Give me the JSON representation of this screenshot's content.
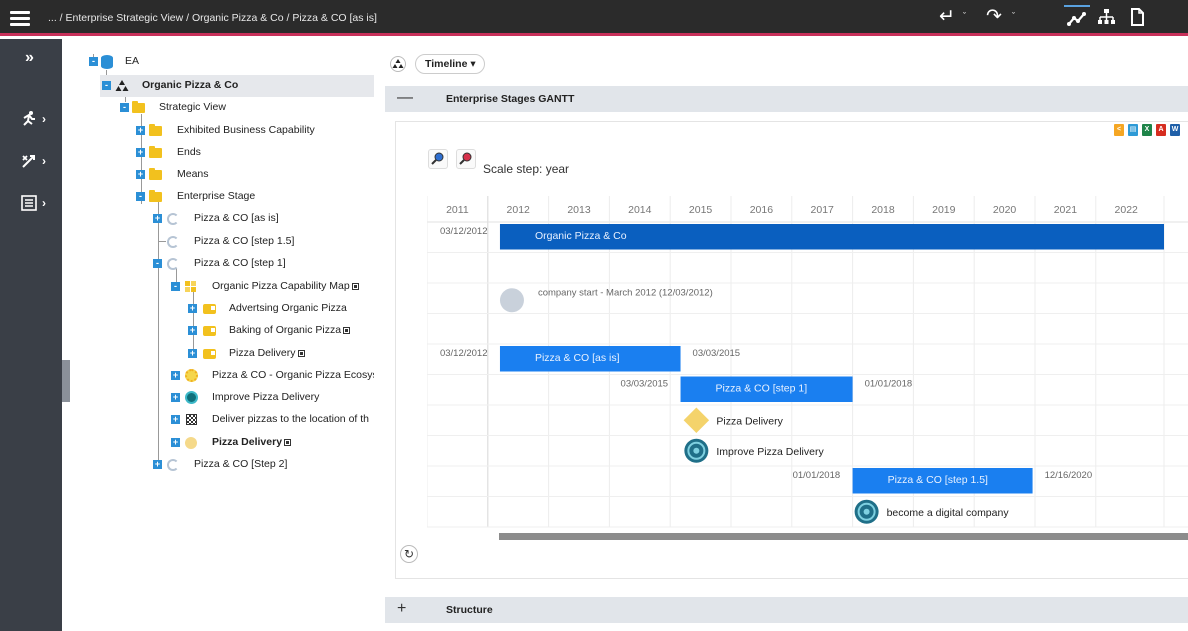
{
  "topbar": {
    "breadcrumb": "... / Enterprise Strategic View / Organic Pizza & Co / Pizza & CO [as is]",
    "icons": [
      "menu-icon",
      "undo-icon",
      "redo-icon",
      "trend-icon",
      "hierarchy-icon",
      "document-icon"
    ]
  },
  "rail": {
    "items": [
      "expand-icon",
      "runner-icon",
      "strategy-icon",
      "list-icon"
    ]
  },
  "tree": {
    "items": [
      {
        "label": "EA",
        "icon": "database-icon",
        "bold": false
      },
      {
        "label": "Organic Pizza & Co",
        "icon": "organization-icon",
        "bold": true
      },
      {
        "label": "Strategic View",
        "icon": "folder-icon",
        "bold": false
      },
      {
        "label": "Exhibited Business Capability",
        "icon": "folder-icon",
        "bold": false
      },
      {
        "label": "Ends",
        "icon": "folder-icon",
        "bold": false
      },
      {
        "label": "Means",
        "icon": "folder-icon",
        "bold": false
      },
      {
        "label": "Enterprise Stage",
        "icon": "folder-icon",
        "bold": false
      },
      {
        "label": "Pizza & CO [as is]",
        "icon": "stage-icon",
        "bold": false
      },
      {
        "label": "Pizza & CO [step 1.5]",
        "icon": "stage-icon",
        "bold": false
      },
      {
        "label": "Pizza & CO [step 1]",
        "icon": "stage-icon",
        "bold": false
      },
      {
        "label": "Organic Pizza Capability Map",
        "icon": "capability-map-icon",
        "bold": false
      },
      {
        "label": "Advertsing Organic Pizza",
        "icon": "capability-icon",
        "bold": false
      },
      {
        "label": "Baking of Organic Pizza",
        "icon": "capability-icon",
        "bold": false
      },
      {
        "label": "Pizza Delivery",
        "icon": "capability-icon",
        "bold": false
      },
      {
        "label": "Pizza & CO - Organic Pizza Ecosys",
        "icon": "ecosystem-icon",
        "bold": false
      },
      {
        "label": "Improve Pizza Delivery",
        "icon": "goal-icon",
        "bold": false
      },
      {
        "label": "Deliver pizzas to the location of th",
        "icon": "checkered-icon",
        "bold": false
      },
      {
        "label": "Pizza Delivery",
        "icon": "value-icon",
        "bold": true
      },
      {
        "label": "Pizza & CO [Step 2]",
        "icon": "stage-icon",
        "bold": false
      }
    ]
  },
  "main": {
    "view_select": "Timeline",
    "view_caret": "▾",
    "sections": {
      "gantt_title": "Enterprise Stages GANTT",
      "gantt_toggle": "—",
      "structure_title": "Structure",
      "structure_toggle": "+"
    },
    "scale_text": "Scale step: year",
    "reset_glyph": "↻",
    "exports": [
      {
        "icon": "share-icon",
        "color": "#f5a623",
        "glyph": "<"
      },
      {
        "icon": "doc-icon",
        "color": "#2e9ad6",
        "glyph": "▤"
      },
      {
        "icon": "excel-icon",
        "color": "#1e8449",
        "glyph": "X"
      },
      {
        "icon": "pdf-icon",
        "color": "#d62d20",
        "glyph": "A"
      },
      {
        "icon": "word-icon",
        "color": "#1f5fa8",
        "glyph": "W"
      }
    ]
  },
  "chart_data": {
    "type": "gantt",
    "years": [
      "2011",
      "2012",
      "2013",
      "2014",
      "2015",
      "2016",
      "2017",
      "2018",
      "2019",
      "2020",
      "2021",
      "2022"
    ],
    "rows": [
      {
        "kind": "bar",
        "label": "Organic Pizza & Co",
        "start_label": "03/12/2012",
        "end_label": "",
        "start": 2012.2,
        "end": 2023.2,
        "color": "#0a5fbf"
      },
      {
        "kind": "empty"
      },
      {
        "kind": "milestone",
        "label": "company start - March 2012 (12/03/2012)",
        "at": 2012.2,
        "shape": "gray-circle"
      },
      {
        "kind": "empty"
      },
      {
        "kind": "bar",
        "label": "Pizza & CO [as is]",
        "start_label": "03/12/2012",
        "end_label": "03/03/2015",
        "start": 2012.2,
        "end": 2015.17,
        "color": "#1a7ff0"
      },
      {
        "kind": "bar",
        "label": "Pizza & CO [step 1]",
        "start_label": "03/03/2015",
        "end_label": "01/01/2018",
        "start": 2015.17,
        "end": 2018.0,
        "color": "#1a7ff0"
      },
      {
        "kind": "milestone",
        "label": "Pizza Delivery",
        "at": 2015.2,
        "shape": "yellow-diamond"
      },
      {
        "kind": "milestone",
        "label": "Improve Pizza Delivery",
        "at": 2015.2,
        "shape": "goal-circle"
      },
      {
        "kind": "bar",
        "label": "Pizza & CO [step 1.5]",
        "start_label": "01/01/2018",
        "end_label": "12/16/2020",
        "start": 2018.0,
        "end": 2020.96,
        "color": "#1a7ff0"
      },
      {
        "kind": "milestone",
        "label": "become a digital company",
        "at": 2018.0,
        "shape": "goal-circle"
      }
    ]
  }
}
